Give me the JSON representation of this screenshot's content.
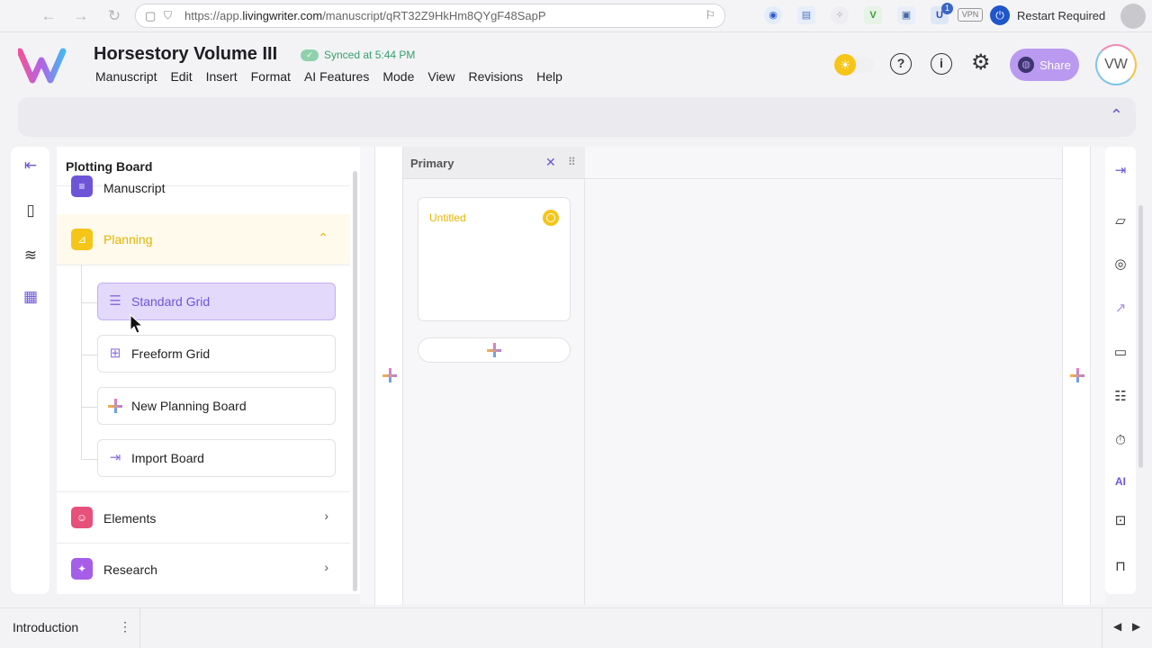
{
  "browser": {
    "url_prefix": "https://app.",
    "url_host": "livingwriter.com",
    "url_path": "/manuscript/qRT32Z9HkHm8QYgF48SapP",
    "restart_label": "Restart Required",
    "vpn_label": "VPN",
    "ext_badge": "1"
  },
  "header": {
    "doc_title": "Horsestory Volume III",
    "sync_status": "Synced at 5:44 PM",
    "menu": [
      "Manuscript",
      "Edit",
      "Insert",
      "Format",
      "AI Features",
      "Mode",
      "View",
      "Revisions",
      "Help"
    ],
    "share_label": "Share",
    "avatar_initials": "VW"
  },
  "sidebar": {
    "title": "Plotting Board",
    "sections": {
      "manuscript": "Manuscript",
      "planning": "Planning",
      "elements": "Elements",
      "research": "Research"
    },
    "planning_items": [
      {
        "label": "Standard Grid",
        "icon": "list-lines-icon"
      },
      {
        "label": "Freeform Grid",
        "icon": "grid-squares-icon"
      },
      {
        "label": "New Planning Board",
        "icon": "plus-icon"
      },
      {
        "label": "Import Board",
        "icon": "import-file-icon"
      }
    ]
  },
  "board": {
    "column_title": "Primary",
    "card_title": "Untitled"
  },
  "right_rail": {
    "ai_label": "AI"
  },
  "bottom": {
    "chapter": "Introduction"
  },
  "colors": {
    "accent_purple": "#6e55d8",
    "planning_yellow": "#f5c518",
    "elements_pink": "#e6507a",
    "research_purple": "#a65de8"
  }
}
